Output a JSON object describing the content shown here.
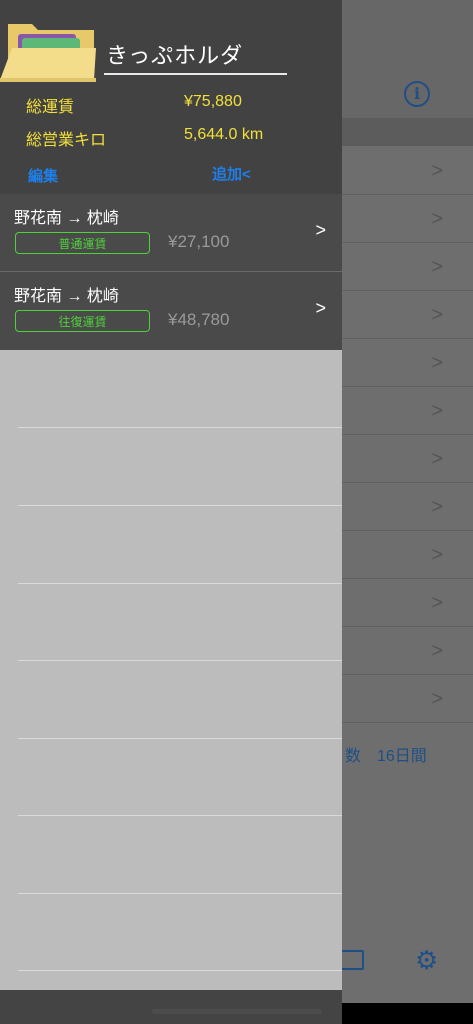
{
  "drawer": {
    "title": "きっぷホルダ",
    "stats": [
      {
        "label": "総運賃",
        "value": "¥75,880"
      },
      {
        "label": "総営業キロ",
        "value": "5,644.0 km"
      }
    ],
    "edit_label": "編集",
    "add_label": "追加<",
    "tickets": [
      {
        "route": "野花南 → 枕崎",
        "type": "普通運賃",
        "fare": "¥27,100"
      },
      {
        "route": "野花南 → 枕崎",
        "type": "往復運賃",
        "fare": "¥48,780"
      }
    ]
  },
  "background": {
    "info_symbol": "i",
    "footer_text": "数　16日間"
  },
  "colors": {
    "accent_blue": "#1f7ee8",
    "highlight_yellow": "#f2e03a",
    "badge_green": "#4fd13a"
  }
}
